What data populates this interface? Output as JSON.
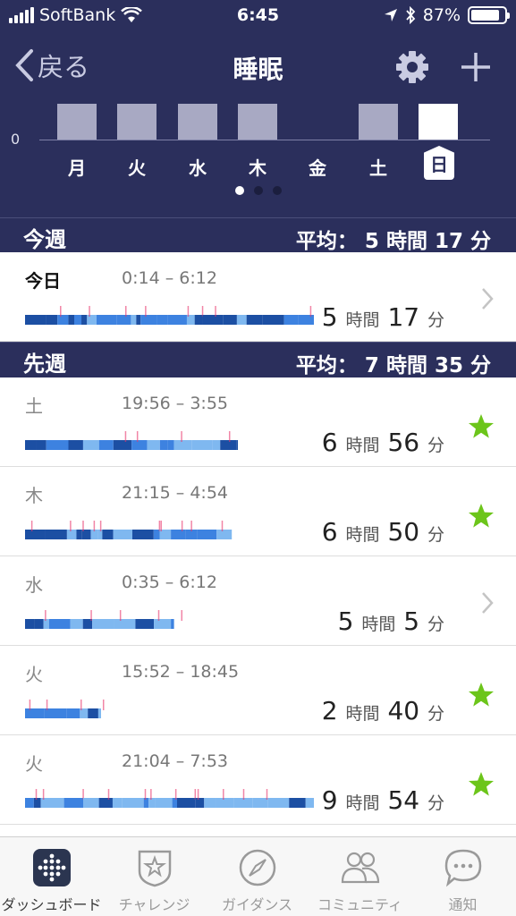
{
  "status_bar": {
    "carrier": "SoftBank",
    "time": "6:45",
    "battery": "87%",
    "battery_level": 0.87
  },
  "nav": {
    "back_label": "戻る",
    "title": "睡眠",
    "settings_icon": "gear-icon",
    "add_icon": "plus-icon"
  },
  "week_chart": {
    "zero_label": "0",
    "days": [
      {
        "label": "月",
        "has_bar": true,
        "today": false
      },
      {
        "label": "火",
        "has_bar": true,
        "today": false
      },
      {
        "label": "水",
        "has_bar": true,
        "today": false
      },
      {
        "label": "木",
        "has_bar": true,
        "today": false
      },
      {
        "label": "金",
        "has_bar": false,
        "today": false
      },
      {
        "label": "土",
        "has_bar": true,
        "today": false
      },
      {
        "label": "日",
        "has_bar": true,
        "today": true
      }
    ],
    "page_dots": 3,
    "active_dot": 0
  },
  "this_week": {
    "label": "今週",
    "avg_prefix": "平均：",
    "avg_h": "5",
    "avg_m": "17",
    "entries": [
      {
        "day": "今日",
        "range": "0:14 – 6:12",
        "hours": "5",
        "minutes": "17",
        "mark": "chevron"
      }
    ]
  },
  "last_week": {
    "label": "先週",
    "avg_prefix": "平均：",
    "avg_h": "7",
    "avg_m": "35",
    "entries": [
      {
        "day": "土",
        "range": "19:56 – 3:55",
        "hours": "6",
        "minutes": "56",
        "mark": "star"
      },
      {
        "day": "木",
        "range": "21:15 – 4:54",
        "hours": "6",
        "minutes": "50",
        "mark": "star"
      },
      {
        "day": "水",
        "range": "0:35 – 6:12",
        "hours": "5",
        "minutes": "5",
        "mark": "chevron"
      },
      {
        "day": "火",
        "range": "15:52 – 18:45",
        "hours": "2",
        "minutes": "40",
        "mark": "star"
      },
      {
        "day": "火",
        "range": "21:04 – 7:53",
        "hours": "9",
        "minutes": "54",
        "mark": "star"
      }
    ]
  },
  "units": {
    "hour": "時間",
    "minute": "分"
  },
  "tabs": [
    {
      "label": "ダッシュボード",
      "icon": "dashboard-icon",
      "active": true
    },
    {
      "label": "チャレンジ",
      "icon": "challenge-star-icon",
      "active": false
    },
    {
      "label": "ガイダンス",
      "icon": "compass-icon",
      "active": false
    },
    {
      "label": "コミュニティ",
      "icon": "people-icon",
      "active": false
    },
    {
      "label": "通知",
      "icon": "chat-bubble-icon",
      "active": false
    }
  ],
  "colors": {
    "header_bg": "#2b2f5c",
    "star": "#6cc51a",
    "sleep_light": "#7fb8f0",
    "sleep_mid": "#3d82e0",
    "sleep_deep": "#1c4fa3",
    "awake": "#e8336b"
  }
}
